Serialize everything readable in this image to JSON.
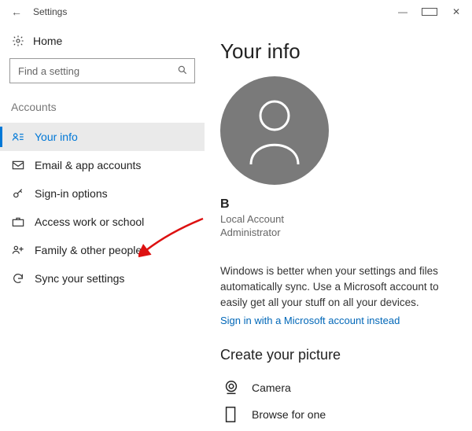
{
  "window": {
    "title": "Settings"
  },
  "sidebar": {
    "home_label": "Home",
    "search_placeholder": "Find a setting",
    "category_label": "Accounts",
    "items": [
      {
        "label": "Your info"
      },
      {
        "label": "Email & app accounts"
      },
      {
        "label": "Sign-in options"
      },
      {
        "label": "Access work or school"
      },
      {
        "label": "Family & other people"
      },
      {
        "label": "Sync your settings"
      }
    ]
  },
  "page": {
    "title": "Your info",
    "username": "B",
    "account_type": "Local Account",
    "role": "Administrator",
    "upsell_text": "Windows is better when your settings and files automatically sync. Use a Microsoft account to easily get all your stuff on all your devices.",
    "signin_link": "Sign in with a Microsoft account instead",
    "create_picture_heading": "Create your picture",
    "camera_label": "Camera",
    "browse_label": "Browse for one"
  }
}
